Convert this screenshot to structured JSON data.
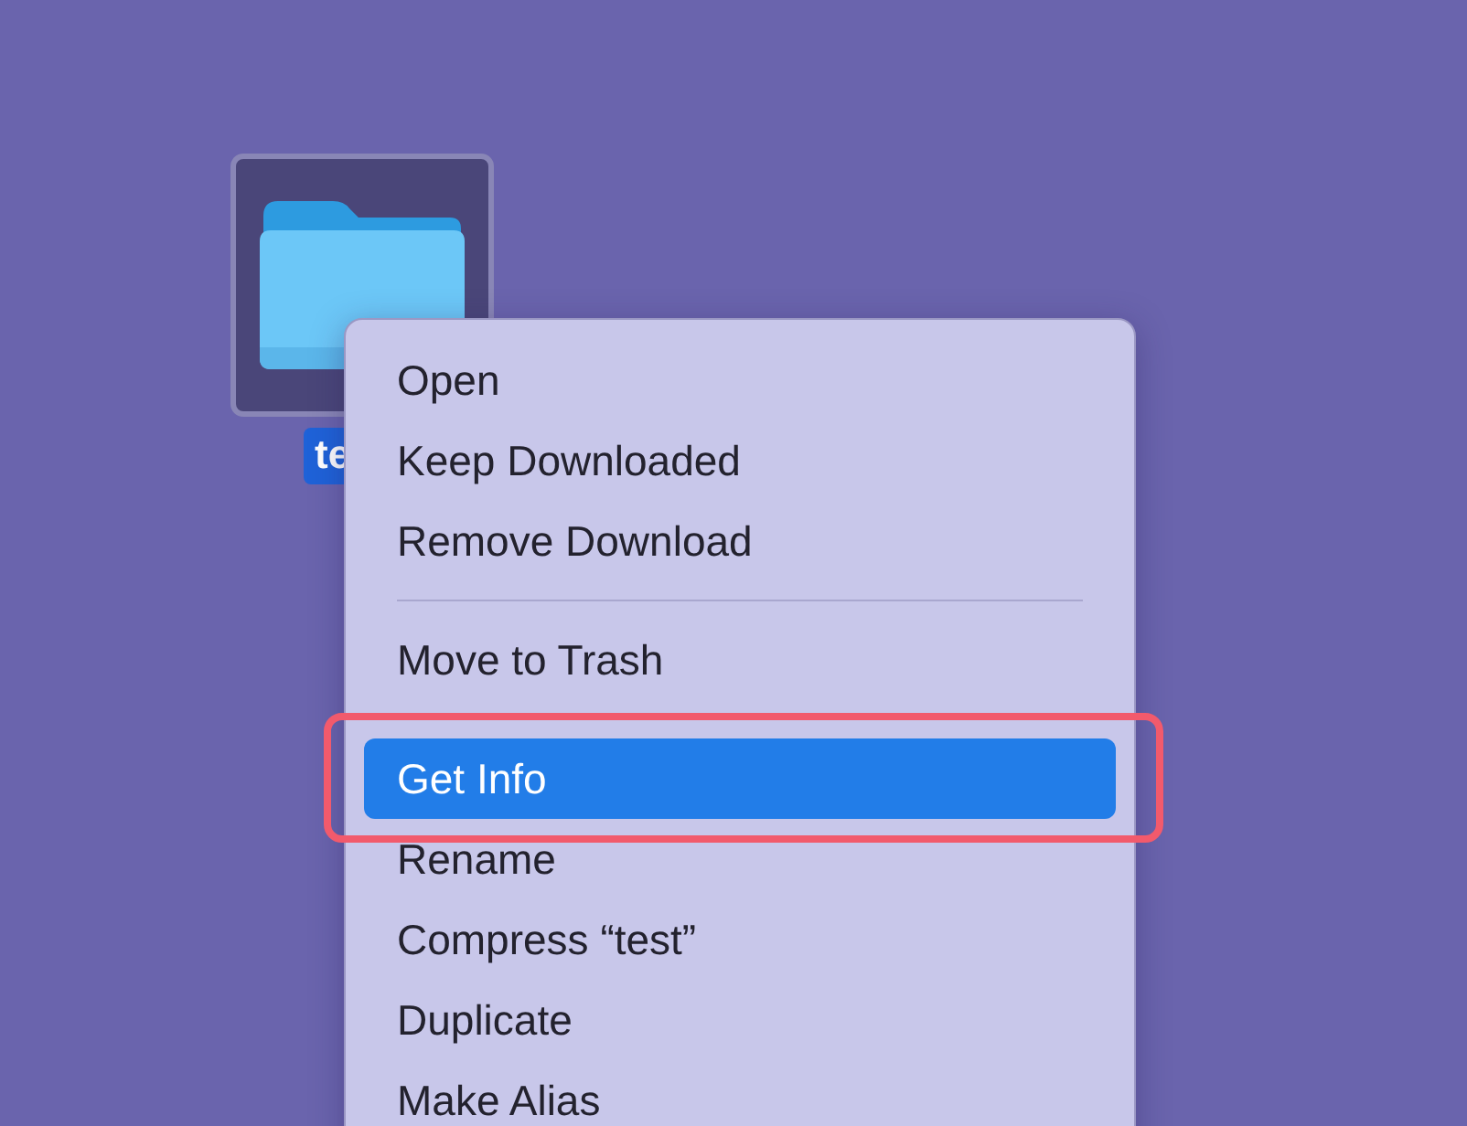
{
  "desktop_item": {
    "kind": "folder",
    "label": "te",
    "selected": true
  },
  "context_menu": {
    "groups": [
      [
        {
          "label": "Open",
          "selected": false,
          "outlined": false
        },
        {
          "label": "Keep Downloaded",
          "selected": false,
          "outlined": false
        },
        {
          "label": "Remove Download",
          "selected": false,
          "outlined": false
        }
      ],
      [
        {
          "label": "Move to Trash",
          "selected": false,
          "outlined": false
        }
      ],
      [
        {
          "label": "Get Info",
          "selected": true,
          "outlined": true
        },
        {
          "label": "Rename",
          "selected": false,
          "outlined": false
        },
        {
          "label": "Compress “test”",
          "selected": false,
          "outlined": false
        },
        {
          "label": "Duplicate",
          "selected": false,
          "outlined": false
        },
        {
          "label": "Make Alias",
          "selected": false,
          "outlined": false
        }
      ]
    ]
  }
}
